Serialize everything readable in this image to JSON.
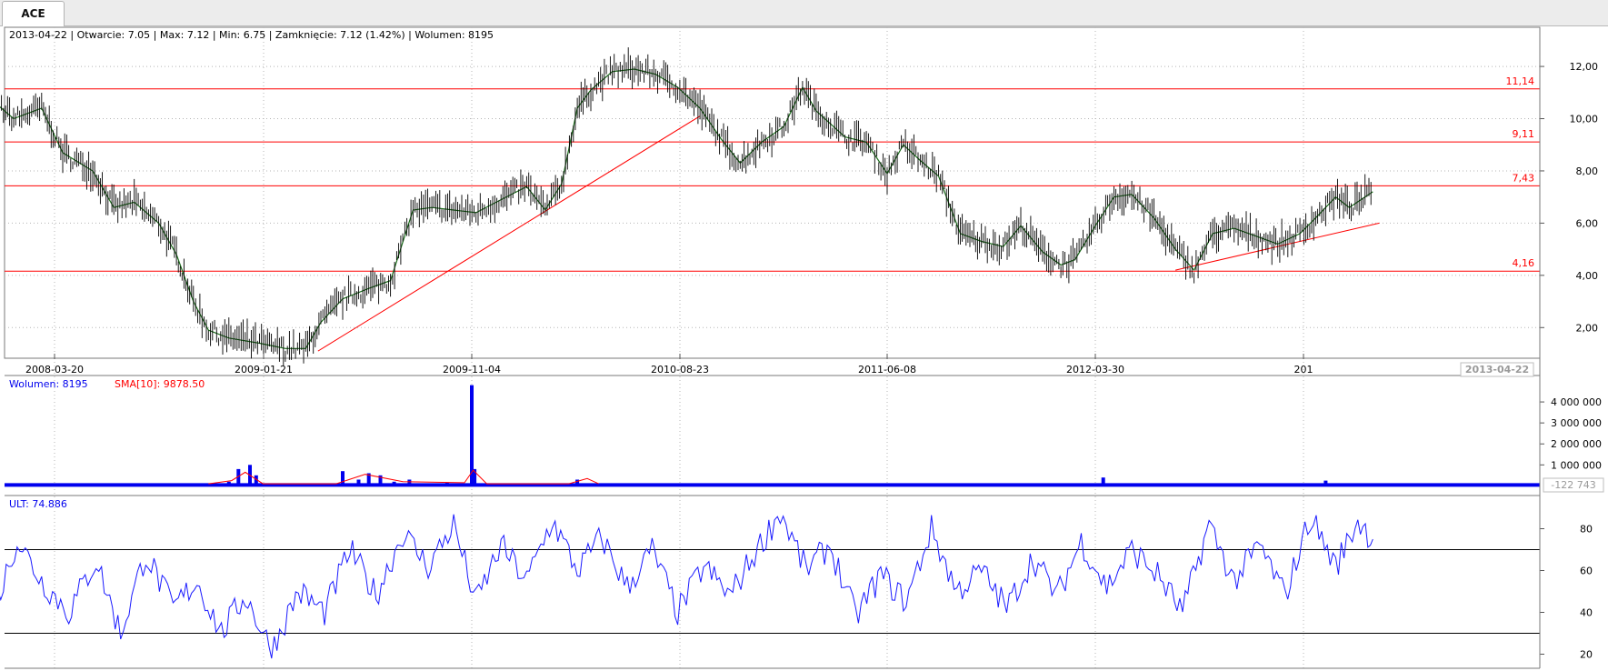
{
  "tab": {
    "label": "ACE"
  },
  "info_line": "2013-04-22 | Otwarcie: 7.05 | Max: 7.12 | Min: 6.75 | Zamknięcie: 7.12 (1.42%) | Wolumen: 8195",
  "volume_legend": {
    "wolumen": "Wolumen: 8195",
    "sma": "SMA[10]: 9878.50"
  },
  "ult_legend": "ULT: 74.886",
  "cursor_date": "2013-04-22",
  "cursor_volume": "-122 743",
  "colors": {
    "candle": "#1a6b1a",
    "support": "#ff0000",
    "volume": "#0000ee",
    "ult": "#1a1aff",
    "grid": "#b5b5b5"
  },
  "chart_data": [
    {
      "type": "line",
      "title": "ACE",
      "x_ticks": [
        "2008-03-20",
        "2009-01-21",
        "2009-11-04",
        "2010-08-23",
        "2011-06-08",
        "2012-03-30",
        "201"
      ],
      "ylim": [
        1.0,
        13.5
      ],
      "y_ticks": [
        "2,00",
        "4,00",
        "6,00",
        "8,00",
        "10,00",
        "12,00"
      ],
      "y_tick_values": [
        2,
        4,
        6,
        8,
        10,
        12
      ],
      "horizontal_levels": [
        {
          "label": "11,14",
          "value": 11.14
        },
        {
          "label": "9,11",
          "value": 9.11
        },
        {
          "label": "7,43",
          "value": 7.43
        },
        {
          "label": "4,16",
          "value": 4.16
        }
      ],
      "trendlines": [
        {
          "from": {
            "date": "2009-04-06",
            "value": 1.1
          },
          "to": {
            "date": "2010-09-20",
            "value": 10.1
          }
        },
        {
          "from": {
            "date": "2012-07-20",
            "value": 4.2
          },
          "to": {
            "date": "2013-05-01",
            "value": 6.0
          }
        }
      ],
      "series": [
        {
          "x": [
            "2007-11-15",
            "2007-12-15",
            "2008-01-20",
            "2008-03-01",
            "2008-04-01",
            "2008-05-15",
            "2008-06-15",
            "2008-07-15",
            "2008-08-20",
            "2008-09-15",
            "2008-10-10",
            "2008-11-01",
            "2008-12-01",
            "2009-01-15",
            "2009-02-20",
            "2009-03-20",
            "2009-04-10",
            "2009-05-10",
            "2009-06-15",
            "2009-07-15",
            "2009-08-15",
            "2009-09-10",
            "2009-10-10",
            "2009-11-10",
            "2009-12-15",
            "2010-01-20",
            "2010-02-15",
            "2010-03-10",
            "2010-04-01",
            "2010-04-20",
            "2010-05-20",
            "2010-06-20",
            "2010-07-20",
            "2010-08-20",
            "2010-09-20",
            "2010-10-20",
            "2010-11-15",
            "2010-12-15",
            "2011-01-15",
            "2011-02-10",
            "2011-03-01",
            "2011-04-10",
            "2011-05-10",
            "2011-06-08",
            "2011-07-01",
            "2011-07-25",
            "2011-08-20",
            "2011-09-20",
            "2011-10-20",
            "2011-11-20",
            "2011-12-15",
            "2012-01-15",
            "2012-02-10",
            "2012-03-01",
            "2012-03-30",
            "2012-04-25",
            "2012-05-20",
            "2012-06-20",
            "2012-07-20",
            "2012-08-15",
            "2012-09-10",
            "2012-10-10",
            "2012-11-10",
            "2012-12-10",
            "2013-01-10",
            "2013-02-01",
            "2013-03-01",
            "2013-03-20",
            "2013-04-22"
          ],
          "values": [
            11.5,
            10.8,
            10.0,
            10.4,
            8.7,
            8.0,
            6.6,
            6.8,
            6.0,
            4.8,
            3.0,
            1.9,
            1.6,
            1.4,
            1.2,
            1.2,
            2.2,
            3.1,
            3.5,
            3.8,
            6.5,
            6.6,
            6.5,
            6.4,
            6.9,
            7.4,
            6.5,
            7.5,
            10.4,
            11.1,
            11.8,
            11.9,
            11.7,
            11.2,
            10.4,
            9.2,
            8.3,
            9.1,
            9.7,
            11.2,
            10.3,
            9.3,
            9.1,
            7.9,
            9.0,
            8.4,
            7.8,
            5.6,
            5.3,
            5.1,
            5.9,
            4.9,
            4.4,
            4.6,
            5.9,
            7.0,
            7.1,
            6.2,
            5.0,
            4.2,
            5.6,
            5.8,
            5.5,
            5.2,
            5.6,
            6.2,
            7.0,
            6.6,
            7.2
          ]
        }
      ]
    },
    {
      "type": "bar",
      "title": "Wolumen",
      "y_ticks": [
        "1 000 000",
        "2 000 000",
        "3 000 000",
        "4 000 000"
      ],
      "y_tick_values": [
        1000000,
        2000000,
        3000000,
        4000000
      ],
      "ylim": [
        -200000,
        5000000
      ],
      "series": [
        {
          "name": "Wolumen",
          "x": [
            "2008-12-01",
            "2008-12-15",
            "2009-01-01",
            "2009-01-10",
            "2009-05-10",
            "2009-06-01",
            "2009-06-15",
            "2009-07-01",
            "2009-07-20",
            "2009-08-10",
            "2009-10-01",
            "2009-11-04",
            "2009-11-08",
            "2010-04-01",
            "2012-04-10",
            "2013-02-15"
          ],
          "values": [
            200000,
            800000,
            1000000,
            500000,
            700000,
            300000,
            600000,
            500000,
            200000,
            300000,
            150000,
            4800000,
            800000,
            300000,
            400000,
            250000
          ]
        },
        {
          "name": "SMA[10]",
          "x": [
            "2008-11-01",
            "2008-12-05",
            "2008-12-25",
            "2009-01-20",
            "2009-05-01",
            "2009-06-10",
            "2009-08-01",
            "2009-10-25",
            "2009-11-06",
            "2009-11-25",
            "2010-03-20",
            "2010-04-15",
            "2010-05-01"
          ],
          "values": [
            100000,
            250000,
            650000,
            100000,
            100000,
            550000,
            200000,
            150000,
            750000,
            100000,
            100000,
            350000,
            100000
          ]
        }
      ]
    },
    {
      "type": "line",
      "title": "ULT",
      "ylim": [
        15,
        95
      ],
      "y_ticks": [
        "20",
        "40",
        "60",
        "80"
      ],
      "y_tick_values": [
        20,
        40,
        60,
        80
      ],
      "horizontal_levels": [
        {
          "value": 70
        },
        {
          "value": 30
        }
      ],
      "series": [
        {
          "name": "ULT",
          "x": [
            "2007-11-15",
            "2007-12-20",
            "2008-01-25",
            "2008-03-01",
            "2008-04-10",
            "2008-05-20",
            "2008-06-25",
            "2008-08-01",
            "2008-09-10",
            "2008-10-15",
            "2008-11-20",
            "2008-12-25",
            "2009-02-01",
            "2009-03-10",
            "2009-04-15",
            "2009-05-20",
            "2009-06-25",
            "2009-08-01",
            "2009-09-05",
            "2009-10-10",
            "2009-11-10",
            "2009-12-15",
            "2010-01-20",
            "2010-02-25",
            "2010-04-01",
            "2010-05-05",
            "2010-06-10",
            "2010-07-15",
            "2010-08-20",
            "2010-09-25",
            "2010-11-01",
            "2010-12-05",
            "2011-01-10",
            "2011-02-15",
            "2011-03-20",
            "2011-04-25",
            "2011-05-30",
            "2011-07-05",
            "2011-08-10",
            "2011-09-15",
            "2011-10-20",
            "2011-11-25",
            "2012-01-01",
            "2012-02-05",
            "2012-03-10",
            "2012-04-15",
            "2012-05-20",
            "2012-06-25",
            "2012-07-30",
            "2012-09-05",
            "2012-10-10",
            "2012-11-15",
            "2012-12-20",
            "2013-01-25",
            "2013-03-01",
            "2013-04-01",
            "2013-04-22"
          ],
          "values": [
            45,
            38,
            75,
            55,
            40,
            65,
            30,
            68,
            42,
            55,
            30,
            48,
            22,
            50,
            40,
            70,
            48,
            78,
            62,
            82,
            45,
            72,
            55,
            84,
            60,
            76,
            52,
            70,
            40,
            62,
            48,
            68,
            88,
            60,
            72,
            38,
            58,
            45,
            80,
            50,
            60,
            42,
            66,
            48,
            74,
            52,
            70,
            58,
            40,
            82,
            55,
            72,
            48,
            86,
            62,
            84,
            75
          ]
        }
      ]
    }
  ]
}
